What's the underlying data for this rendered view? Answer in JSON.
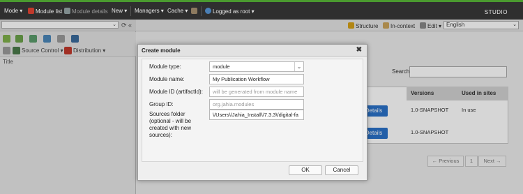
{
  "topbar": {
    "mode": "Mode",
    "module_list": "Module list",
    "module_details": "Module details",
    "new": "New",
    "managers": "Managers",
    "cache": "Cache",
    "logged_as": "Logged as root",
    "studio": "STUDIO"
  },
  "left": {
    "source_control": "Source Control",
    "distribution": "Distribution",
    "title_col": "Title"
  },
  "right_toolbar": {
    "structure": "Structure",
    "in_context": "In-context",
    "edit": "Edit",
    "language": "English"
  },
  "content": {
    "search_label": "Search:",
    "columns": [
      "Versions",
      "Used in sites"
    ],
    "rows": [
      {
        "details": "Details",
        "version": "1.0-SNAPSHOT",
        "used": "In use"
      },
      {
        "details": "Details",
        "version": "1.0-SNAPSHOT",
        "used": ""
      }
    ],
    "pager": {
      "prev": "← Previous",
      "page": "1",
      "next": "Next →"
    }
  },
  "dialog": {
    "title": "Create module",
    "close": "✖",
    "fields": {
      "module_type_label": "Module type:",
      "module_type_value": "module",
      "module_name_label": "Module name:",
      "module_name_value": "My Publication Workflow",
      "module_id_label": "Module ID (artifactId):",
      "module_id_placeholder": "will be generated from module name",
      "group_id_label": "Group ID:",
      "group_id_placeholder": "org.jahia.modules",
      "sources_label": "Sources folder (optional - will be created with new sources):",
      "sources_value": "\\/Users\\/Jahia_Install\\/7.3.3\\/digital-fa"
    },
    "ok": "OK",
    "cancel": "Cancel"
  },
  "colors": {
    "accent_green": "#4a9a2f",
    "details_blue": "#2a72c9",
    "topbar_bg": "#2f2f2f"
  }
}
